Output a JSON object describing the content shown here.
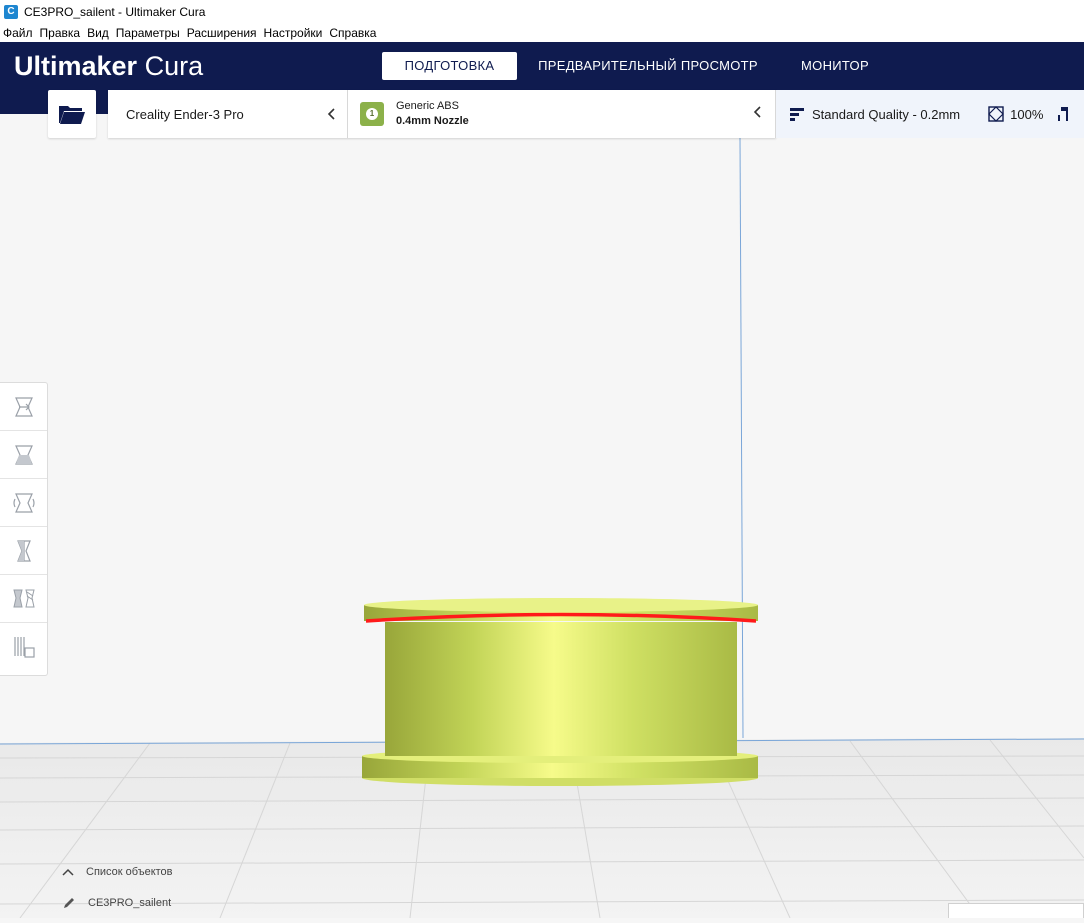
{
  "window": {
    "title": "CE3PRO_sailent - Ultimaker Cura",
    "icon": "cura-app-icon"
  },
  "menu": [
    "Файл",
    "Правка",
    "Вид",
    "Параметры",
    "Расширения",
    "Настройки",
    "Справка"
  ],
  "header": {
    "logo_bold": "Ultimaker",
    "logo_light": " Cura",
    "tabs": [
      {
        "label": "ПОДГОТОВКА",
        "active": true
      },
      {
        "label": "ПРЕДВАРИТЕЛЬНЫЙ ПРОСМОТР",
        "active": false
      },
      {
        "label": "МОНИТОР",
        "active": false
      }
    ]
  },
  "toolbar": {
    "printer": "Creality Ender-3 Pro",
    "extruder_number": "1",
    "material": "Generic ABS",
    "nozzle": "0.4mm Nozzle",
    "quality": "Standard Quality - 0.2mm",
    "infill": "100%"
  },
  "tools": [
    "move-tool-icon",
    "scale-tool-icon",
    "rotate-tool-icon",
    "mirror-tool-icon",
    "per-model-settings-icon",
    "support-blocker-icon"
  ],
  "object_list": {
    "header": "Список объектов",
    "object_name": "CE3PRO_sailent"
  },
  "colors": {
    "header_bg": "#0f1b4f",
    "model_color": "#d7e86a",
    "overhang": "#ff0000",
    "material_badge": "#8cb14a"
  }
}
